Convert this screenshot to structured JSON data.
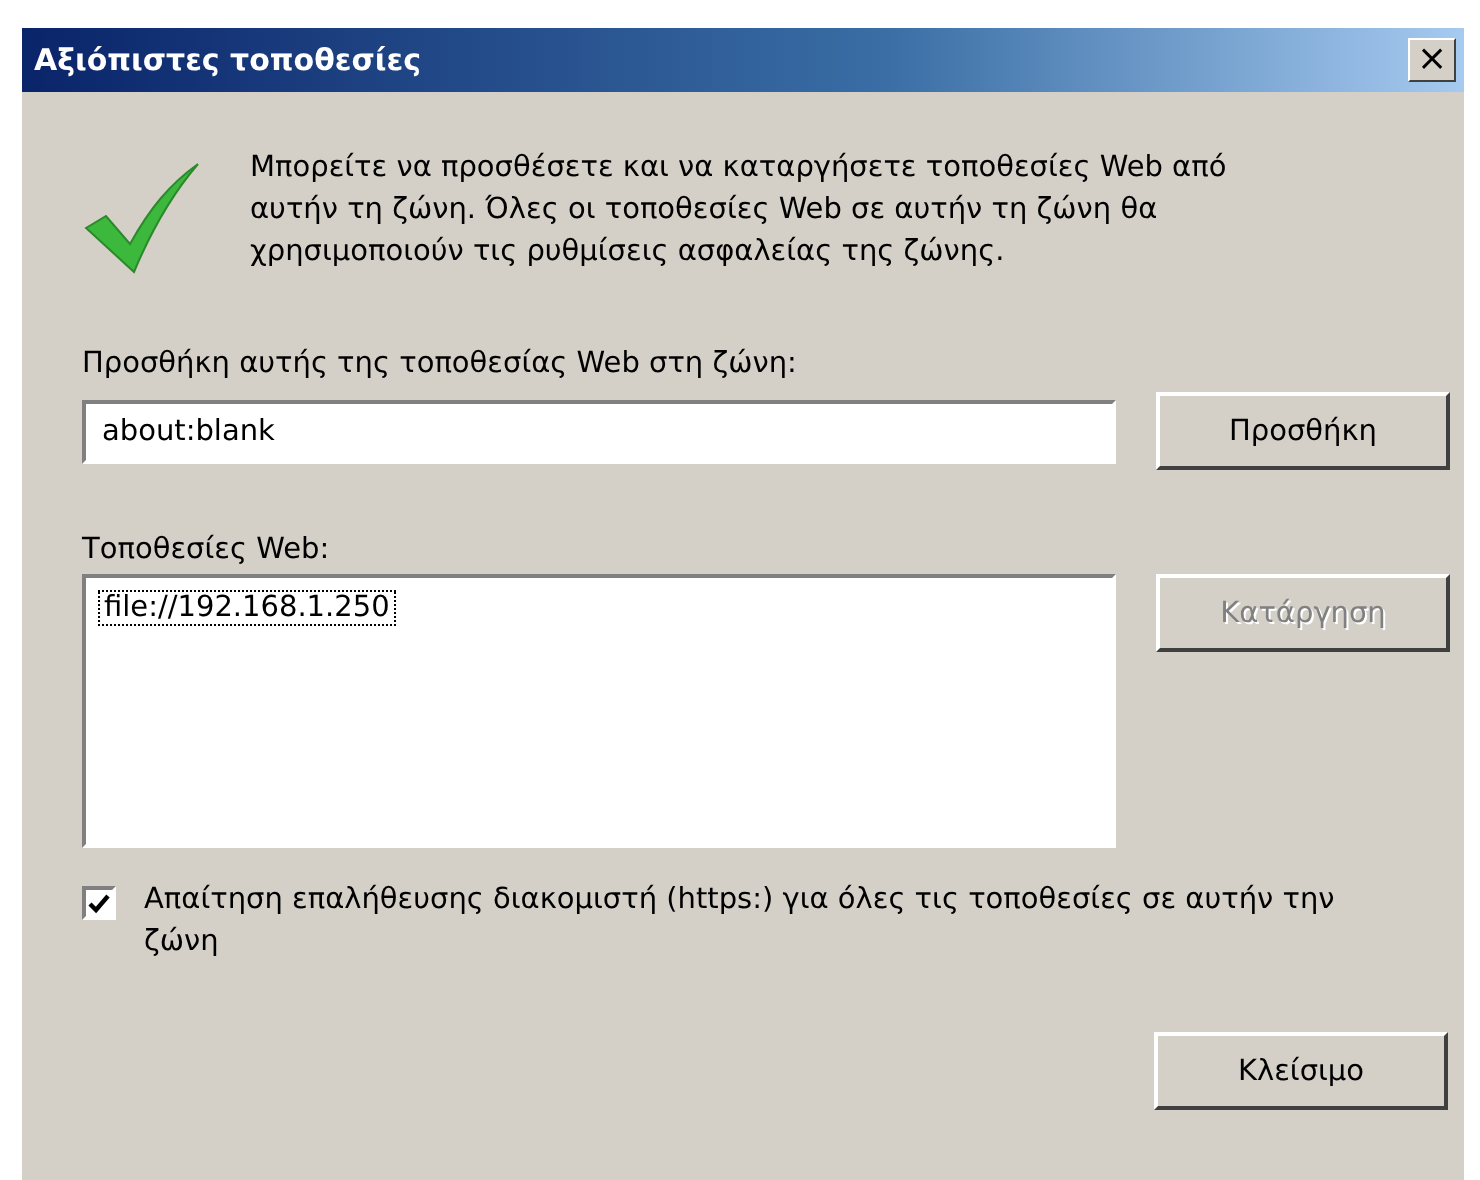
{
  "window": {
    "title": "Αξιόπιστες τοποθεσίες",
    "close": "×"
  },
  "info": "Μπορείτε να προσθέσετε και να καταργήσετε τοποθεσίες Web από αυτήν τη ζώνη. Όλες οι τοποθεσίες Web σε αυτήν τη ζώνη θα χρησιμοποιούν τις ρυθμίσεις ασφαλείας της ζώνης.",
  "add_field": {
    "label": "Προσθήκη αυτής της τοποθεσίας Web στη ζώνη:",
    "value": "about:blank"
  },
  "add_button": {
    "label": "Προσθήκη",
    "disabled": false
  },
  "sites": {
    "label": "Τοποθεσίες Web:",
    "items": [
      {
        "text": "file://192.168.1.250",
        "selected": true
      }
    ]
  },
  "remove_button": {
    "label": "Κατάργηση",
    "disabled": true
  },
  "https_check": {
    "label": "Απαίτηση επαλήθευσης διακομιστή (https:) για όλες τις τοποθεσίες σε αυτήν την ζώνη",
    "checked": true
  },
  "close_button": {
    "label": "Κλείσιμο",
    "disabled": false
  }
}
